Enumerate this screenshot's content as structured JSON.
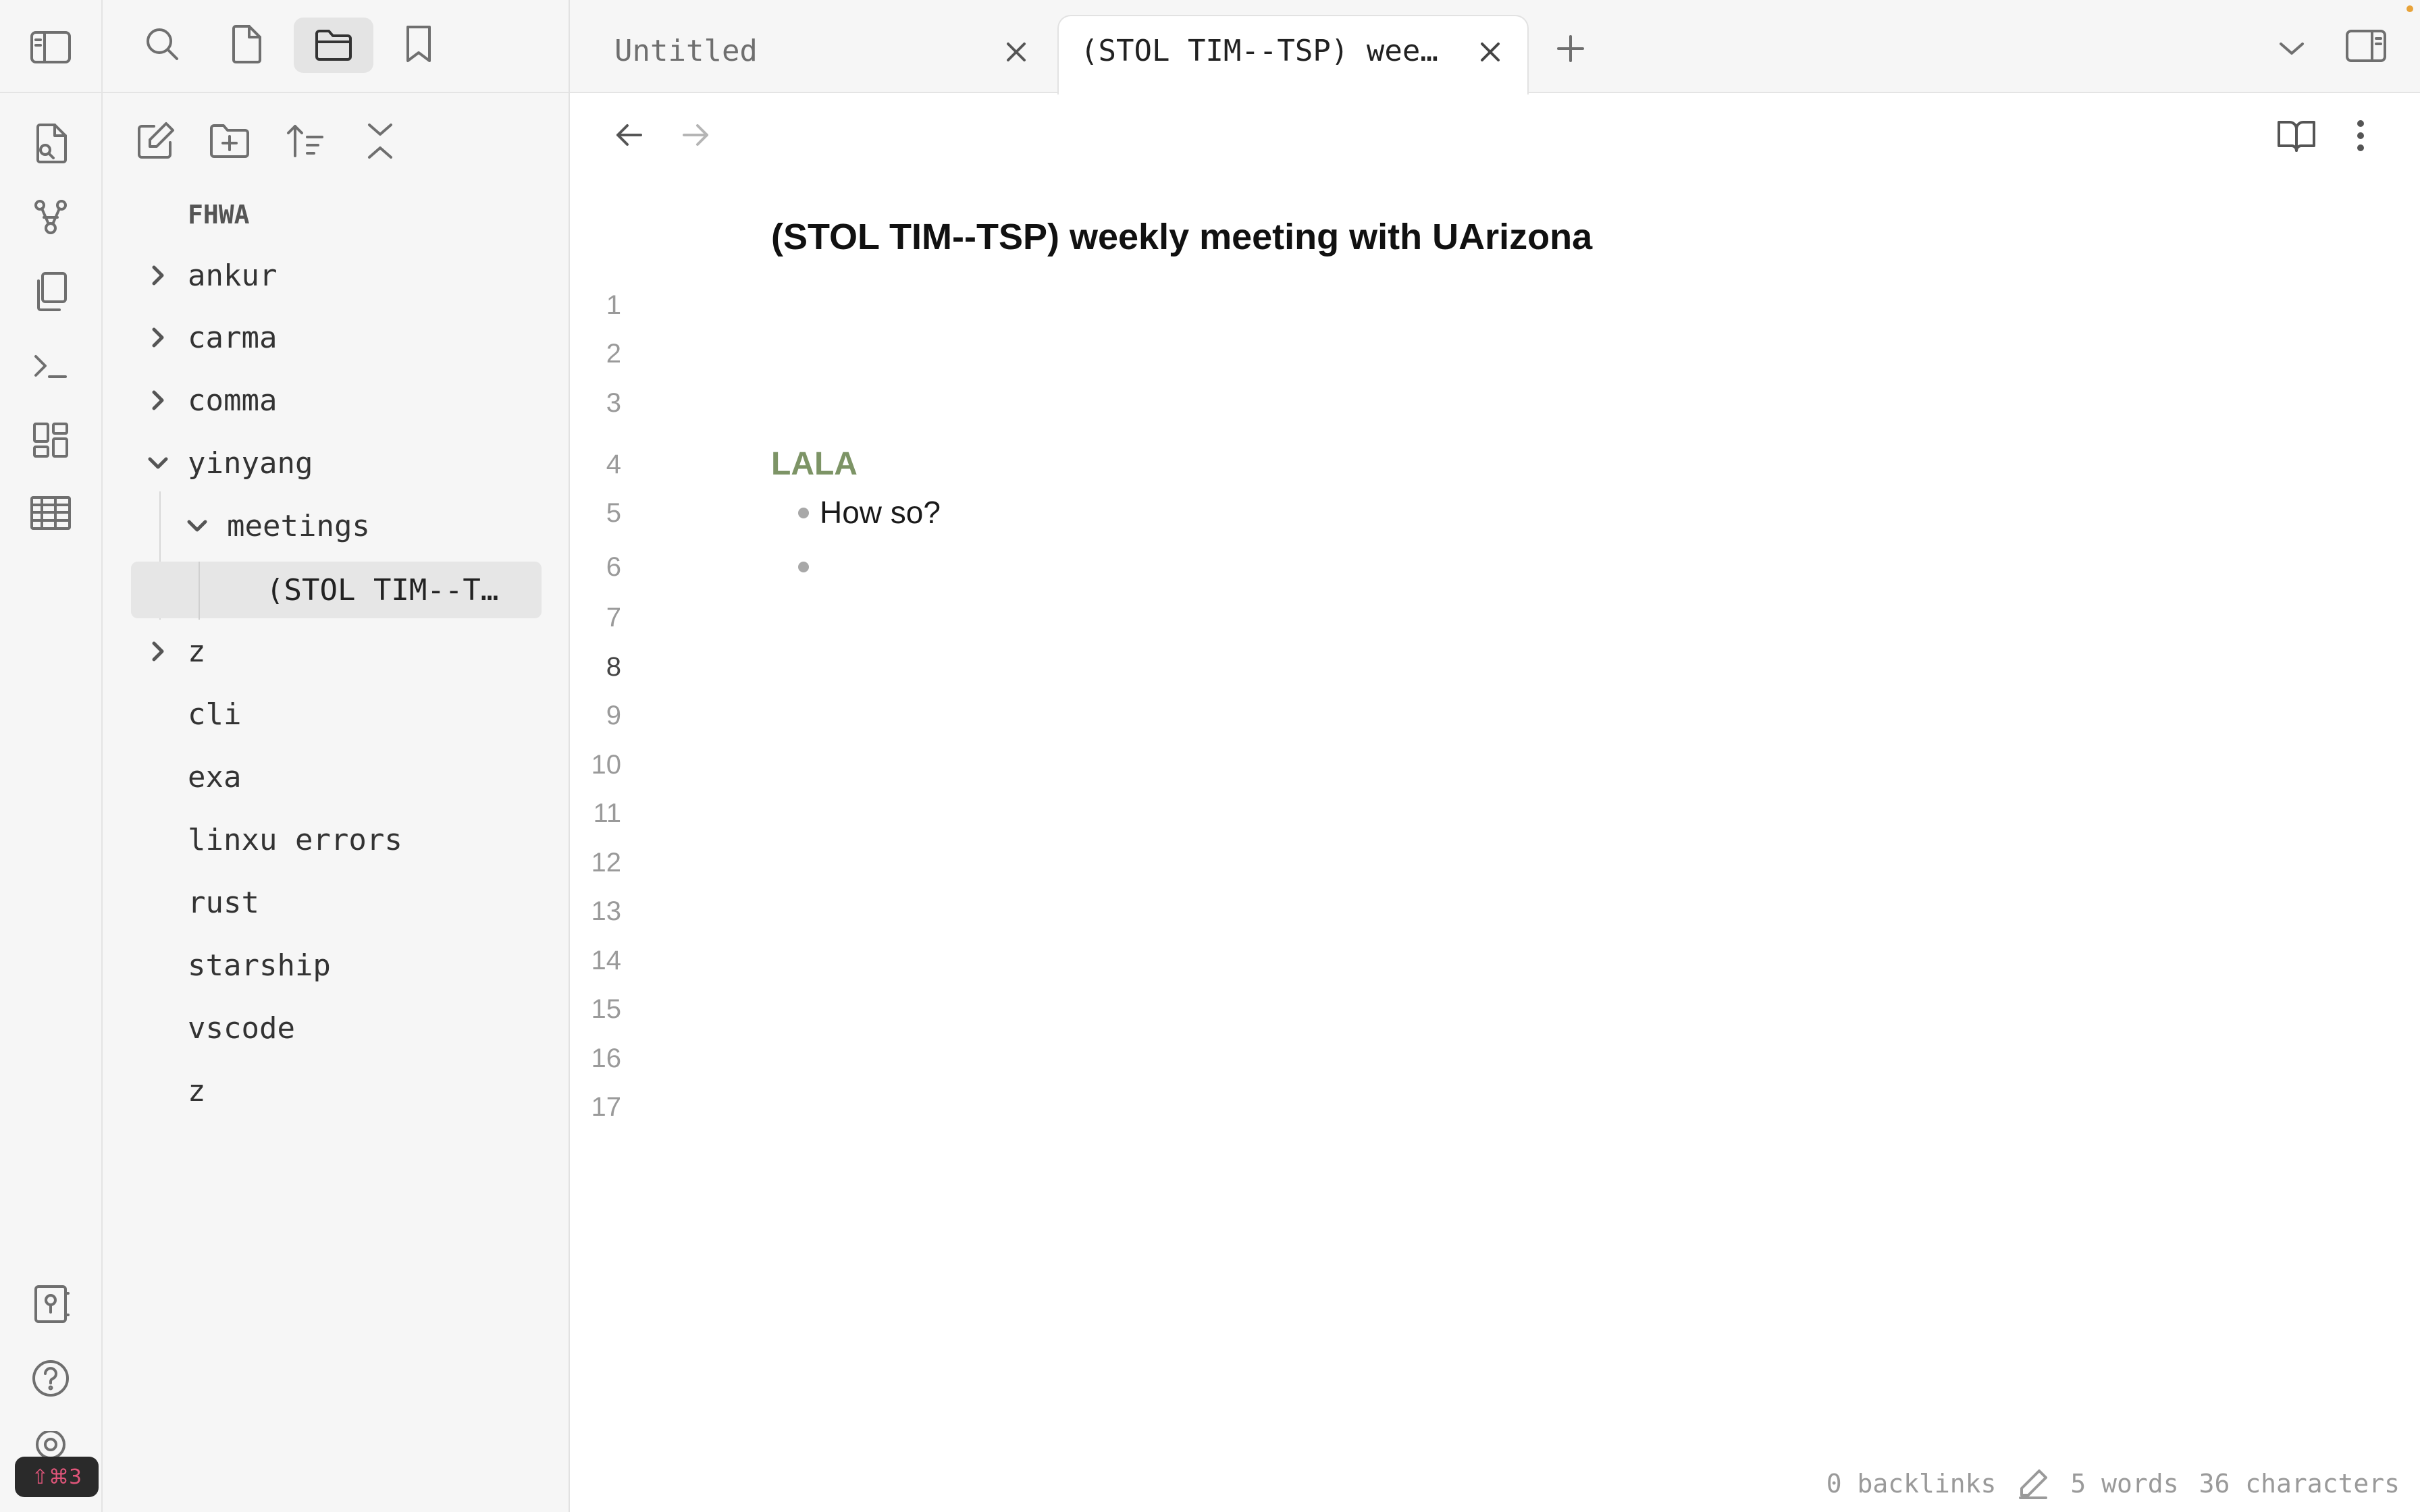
{
  "ribbon": {
    "top_icons": [
      "sidebar-toggle-icon"
    ],
    "icons": [
      "file-search-icon",
      "graph-icon",
      "copy-files-icon",
      "terminal-icon",
      "dashboard-icon",
      "table-icon"
    ],
    "bottom_icons": [
      "vault-icon",
      "help-icon",
      "settings-icon"
    ],
    "hotkey_badge": "⇧⌘3"
  },
  "sidebar": {
    "tabs": [
      "search-icon",
      "file-icon",
      "folder-icon",
      "bookmark-icon"
    ],
    "active_tab": "folder-icon",
    "actions": [
      "new-note-icon",
      "new-folder-icon",
      "sort-icon",
      "collapse-all-icon"
    ],
    "vault_name": "FHWA",
    "tree": [
      {
        "label": "ankur",
        "type": "folder",
        "state": "collapsed",
        "depth": 0
      },
      {
        "label": "carma",
        "type": "folder",
        "state": "collapsed",
        "depth": 0
      },
      {
        "label": "comma",
        "type": "folder",
        "state": "collapsed",
        "depth": 0
      },
      {
        "label": "yinyang",
        "type": "folder",
        "state": "expanded",
        "depth": 0
      },
      {
        "label": "meetings",
        "type": "folder",
        "state": "expanded",
        "depth": 1
      },
      {
        "label": "(STOL TIM--T…",
        "type": "file",
        "state": "selected",
        "depth": 2
      },
      {
        "label": "z",
        "type": "folder",
        "state": "collapsed",
        "depth": 0
      },
      {
        "label": "cli",
        "type": "file",
        "depth": 0
      },
      {
        "label": "exa",
        "type": "file",
        "depth": 0
      },
      {
        "label": "linxu errors",
        "type": "file",
        "depth": 0
      },
      {
        "label": "rust",
        "type": "file",
        "depth": 0
      },
      {
        "label": "starship",
        "type": "file",
        "depth": 0
      },
      {
        "label": "vscode",
        "type": "file",
        "depth": 0
      },
      {
        "label": "z",
        "type": "file",
        "depth": 0
      }
    ]
  },
  "tabs": [
    {
      "title": "Untitled",
      "active": false
    },
    {
      "title": "(STOL TIM--TSP) wee…",
      "active": true
    }
  ],
  "editor": {
    "note_title": "(STOL TIM--TSP) weekly meeting with UArizona",
    "line_numbers": [
      "1",
      "2",
      "3",
      "4",
      "5",
      "6",
      "7",
      "8",
      "9",
      "10",
      "11",
      "12",
      "13",
      "14",
      "15",
      "16",
      "17"
    ],
    "current_line": "8",
    "heading": "LALA",
    "bullets": [
      "How so?",
      ""
    ],
    "colors": {
      "heading": "#7d9466",
      "accent": "#e8a33a",
      "selected_row": "#e6e6e6"
    }
  },
  "status": {
    "backlinks": "0 backlinks",
    "words": "5 words",
    "characters": "36 characters"
  }
}
